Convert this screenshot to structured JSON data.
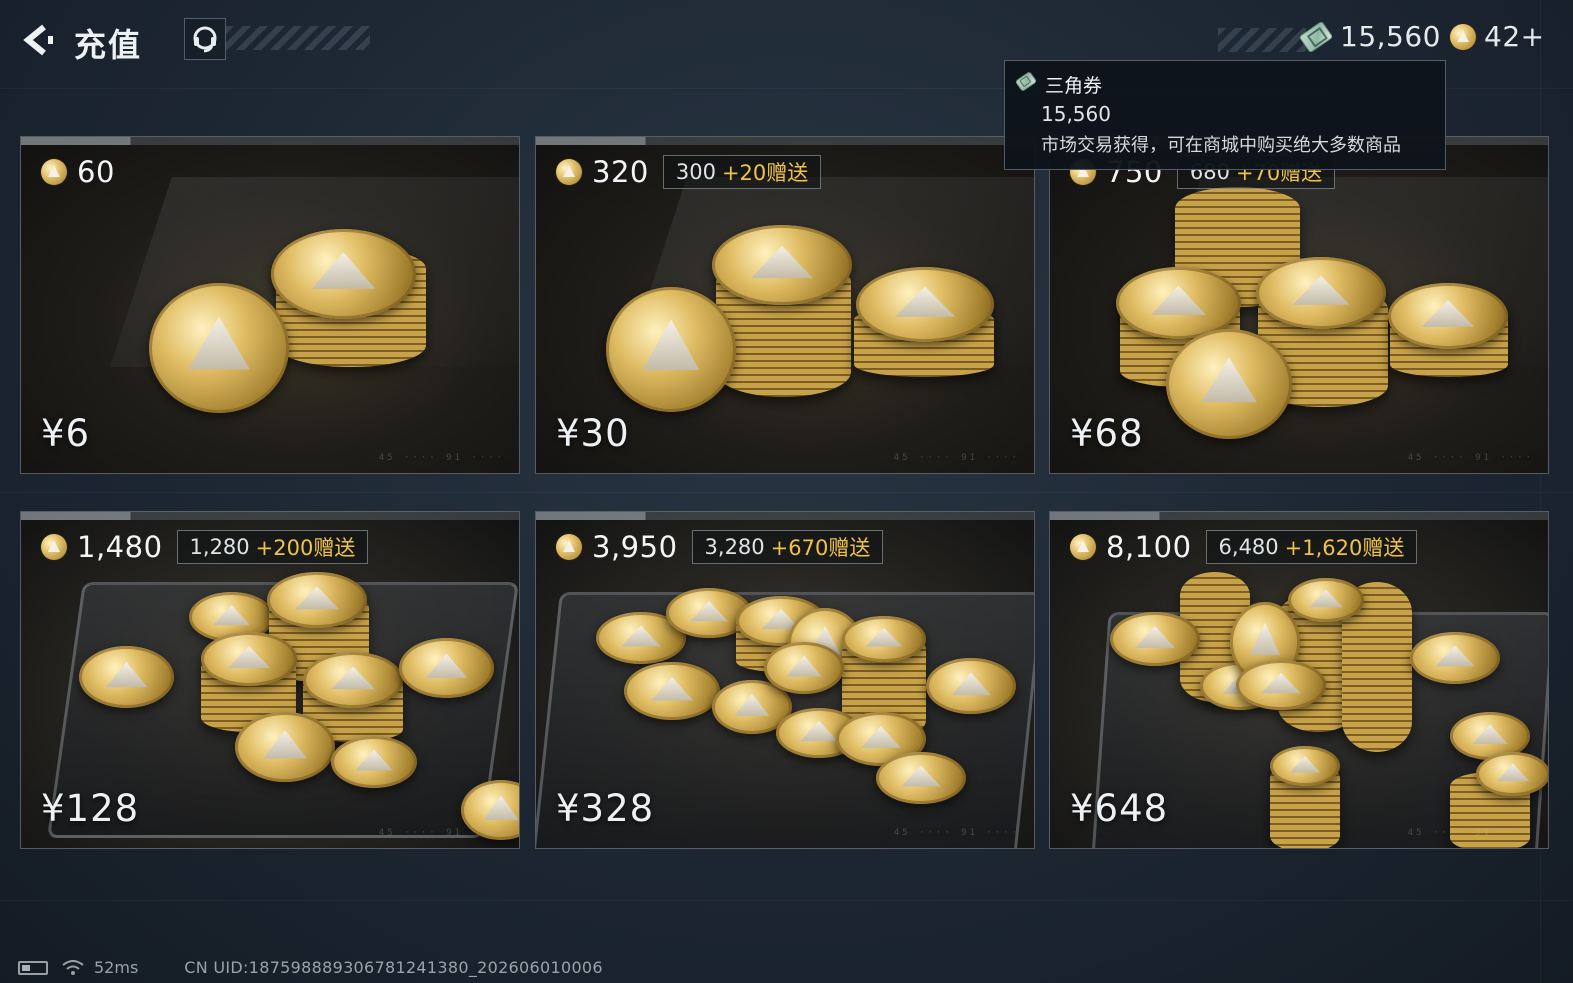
{
  "header": {
    "title": "充值"
  },
  "wallet": {
    "tickets": "15,560",
    "coins": "42+",
    "add_symbol": "+"
  },
  "tooltip": {
    "title": "三角券",
    "value": "15,560",
    "description": "市场交易获得，可在商城中购买绝大多数商品"
  },
  "packages": [
    {
      "amount": "60",
      "bonus_base": "",
      "bonus_extra": "",
      "price": "¥6"
    },
    {
      "amount": "320",
      "bonus_base": "300",
      "bonus_extra": "+20赠送",
      "price": "¥30"
    },
    {
      "amount": "750",
      "bonus_base": "680",
      "bonus_extra": "+70赠送",
      "price": "¥68"
    },
    {
      "amount": "1,480",
      "bonus_base": "1,280",
      "bonus_extra": "+200赠送",
      "price": "¥128"
    },
    {
      "amount": "3,950",
      "bonus_base": "3,280",
      "bonus_extra": "+670赠送",
      "price": "¥328"
    },
    {
      "amount": "8,100",
      "bonus_base": "6,480",
      "bonus_extra": "+1,620赠送",
      "price": "¥648"
    }
  ],
  "status_bar": {
    "ping": "52ms",
    "uid": "CN UID:1875988893067812413​80_202606010006"
  },
  "colors": {
    "bonus_accent": "#f0c24a",
    "background": "#1d2733"
  }
}
